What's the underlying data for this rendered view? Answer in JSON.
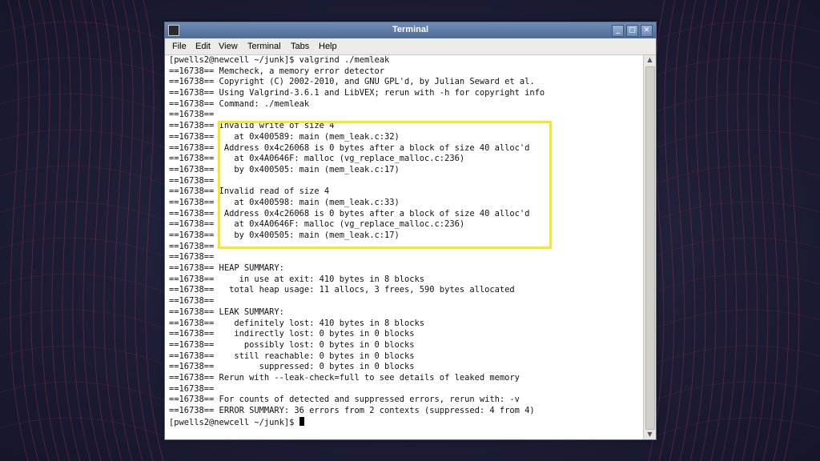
{
  "window": {
    "title": "Terminal",
    "buttons": {
      "minimize": "_",
      "maximize": "□",
      "close": "✕"
    }
  },
  "menu": {
    "items": [
      "File",
      "Edit",
      "View",
      "Terminal",
      "Tabs",
      "Help"
    ]
  },
  "terminal": {
    "lines": [
      "[pwells2@newcell ~/junk]$ valgrind ./memleak",
      "==16738== Memcheck, a memory error detector",
      "==16738== Copyright (C) 2002-2010, and GNU GPL'd, by Julian Seward et al.",
      "==16738== Using Valgrind-3.6.1 and LibVEX; rerun with -h for copyright info",
      "==16738== Command: ./memleak",
      "==16738==",
      "==16738== Invalid write of size 4",
      "==16738==    at 0x400589: main (mem_leak.c:32)",
      "==16738==  Address 0x4c26068 is 0 bytes after a block of size 40 alloc'd",
      "==16738==    at 0x4A0646F: malloc (vg_replace_malloc.c:236)",
      "==16738==    by 0x400505: main (mem_leak.c:17)",
      "==16738==",
      "==16738== Invalid read of size 4",
      "==16738==    at 0x400598: main (mem_leak.c:33)",
      "==16738==  Address 0x4c26068 is 0 bytes after a block of size 40 alloc'd",
      "==16738==    at 0x4A0646F: malloc (vg_replace_malloc.c:236)",
      "==16738==    by 0x400505: main (mem_leak.c:17)",
      "==16738==",
      "==16738==",
      "==16738== HEAP SUMMARY:",
      "==16738==     in use at exit: 410 bytes in 8 blocks",
      "==16738==   total heap usage: 11 allocs, 3 frees, 590 bytes allocated",
      "==16738==",
      "==16738== LEAK SUMMARY:",
      "==16738==    definitely lost: 410 bytes in 8 blocks",
      "==16738==    indirectly lost: 0 bytes in 0 blocks",
      "==16738==      possibly lost: 0 bytes in 0 blocks",
      "==16738==    still reachable: 0 bytes in 0 blocks",
      "==16738==         suppressed: 0 bytes in 0 blocks",
      "==16738== Rerun with --leak-check=full to see details of leaked memory",
      "==16738==",
      "==16738== For counts of detected and suppressed errors, rerun with: -v",
      "==16738== ERROR SUMMARY: 36 errors from 2 contexts (suppressed: 4 from 4)",
      "[pwells2@newcell ~/junk]$ "
    ],
    "highlight_color": "#f5e72a"
  }
}
